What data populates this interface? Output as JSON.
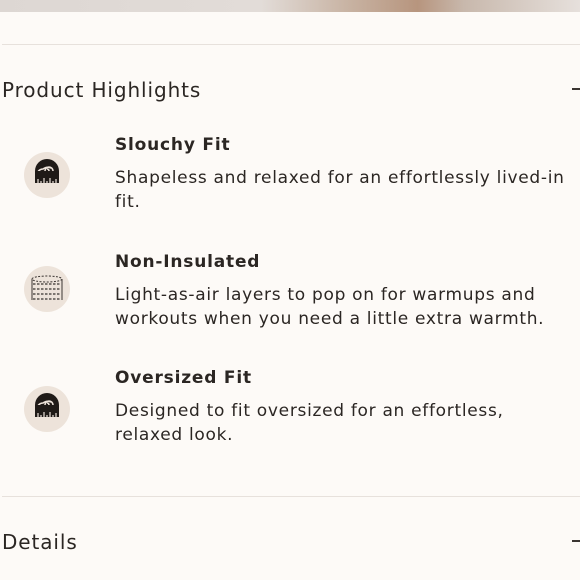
{
  "sections": {
    "highlights": {
      "title": "Product Highlights",
      "toggle_icon": "minus-icon",
      "items": [
        {
          "title": "Slouchy Fit",
          "description": "Shapeless and relaxed for an effortlessly lived-in fit.",
          "icon": "measuring-tape-icon"
        },
        {
          "title": "Non-Insulated",
          "description": "Light-as-air layers to pop on for warmups and workouts when you need a little extra warmth.",
          "icon": "lightweight-fabric-icon"
        },
        {
          "title": "Oversized Fit",
          "description": "Designed to fit oversized for an effortless, relaxed look.",
          "icon": "measuring-tape-icon"
        }
      ]
    },
    "details": {
      "title": "Details",
      "toggle_icon": "minus-icon"
    }
  },
  "colors": {
    "background": "#fdfaf7",
    "icon_bg": "#ede3da",
    "text": "#2b2623",
    "divider": "#e7e1dc"
  }
}
